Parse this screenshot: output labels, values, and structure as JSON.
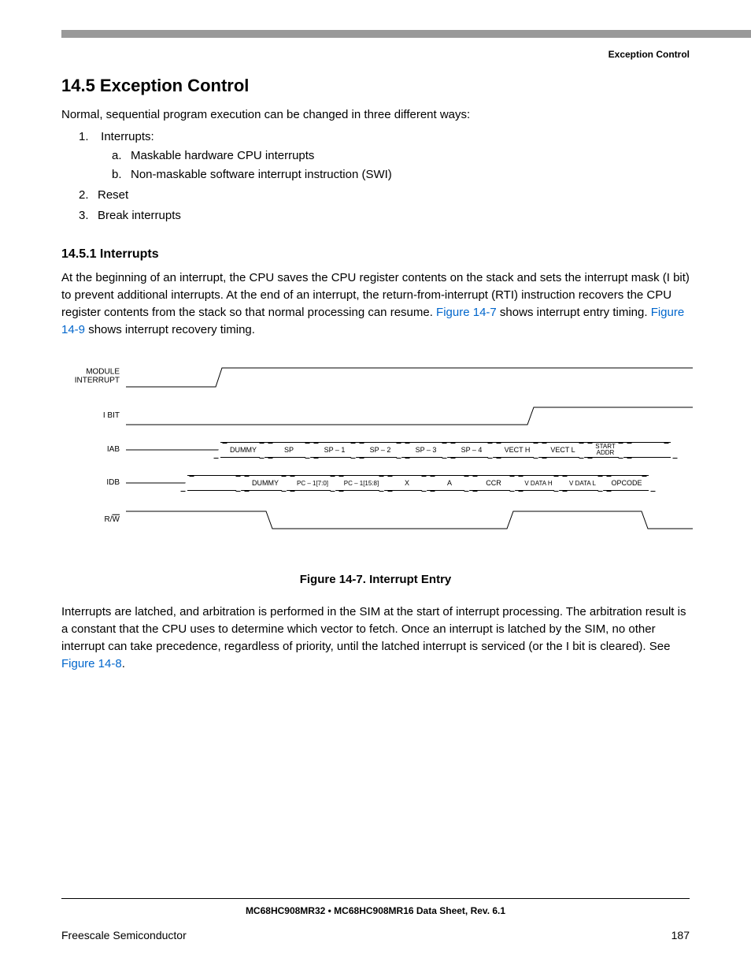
{
  "header": {
    "section_label": "Exception Control"
  },
  "section": {
    "heading": "14.5  Exception Control",
    "intro": "Normal, sequential program execution can be changed in three different ways:",
    "list": [
      {
        "num": "1",
        "text": "Interrupts:",
        "sub": [
          {
            "letter": "a",
            "text": "Maskable hardware CPU interrupts"
          },
          {
            "letter": "b",
            "text": "Non-maskable software interrupt instruction (SWI)"
          }
        ]
      },
      {
        "num": "2",
        "text": "Reset"
      },
      {
        "num": "3",
        "text": "Break interrupts"
      }
    ],
    "subheading": "14.5.1  Interrupts",
    "para1_a": "At the beginning of an interrupt, the CPU saves the CPU register contents on the stack and sets the interrupt mask (I bit) to prevent additional interrupts. At the end of an interrupt, the return-from-interrupt (RTI) instruction recovers the CPU register contents from the stack so that normal processing can resume. ",
    "link1": "Figure 14-7",
    "para1_b": " shows interrupt entry timing. ",
    "link2": "Figure 14-9",
    "para1_c": " shows interrupt recovery timing.",
    "para2_a": "Interrupts are latched, and arbitration is performed in the SIM at the start of interrupt processing. The arbitration result is a constant that the CPU uses to determine which vector to fetch. Once an interrupt is latched by the SIM, no other interrupt can take precedence, regardless of priority, until the latched interrupt is serviced (or the I bit is cleared). See ",
    "link3": "Figure 14-8",
    "para2_b": "."
  },
  "figure": {
    "caption": "Figure 14-7. Interrupt Entry",
    "rows": {
      "module": "MODULE\nINTERRUPT",
      "ibit": "I BIT",
      "iab": "IAB",
      "idb": "IDB",
      "rw": "R/W"
    },
    "iab_cells": [
      "DUMMY",
      "SP",
      "SP – 1",
      "SP – 2",
      "SP – 3",
      "SP – 4",
      "VECT H",
      "VECT L",
      "START\nADDR"
    ],
    "idb_cells": [
      "DUMMY",
      "PC – 1[7:0]",
      "PC – 1[15:8]",
      "X",
      "A",
      "CCR",
      "V DATA H",
      "V DATA L",
      "OPCODE"
    ]
  },
  "footer": {
    "doc": "MC68HC908MR32 • MC68HC908MR16 Data Sheet, Rev. 6.1",
    "left": "Freescale Semiconductor",
    "right": "187"
  }
}
